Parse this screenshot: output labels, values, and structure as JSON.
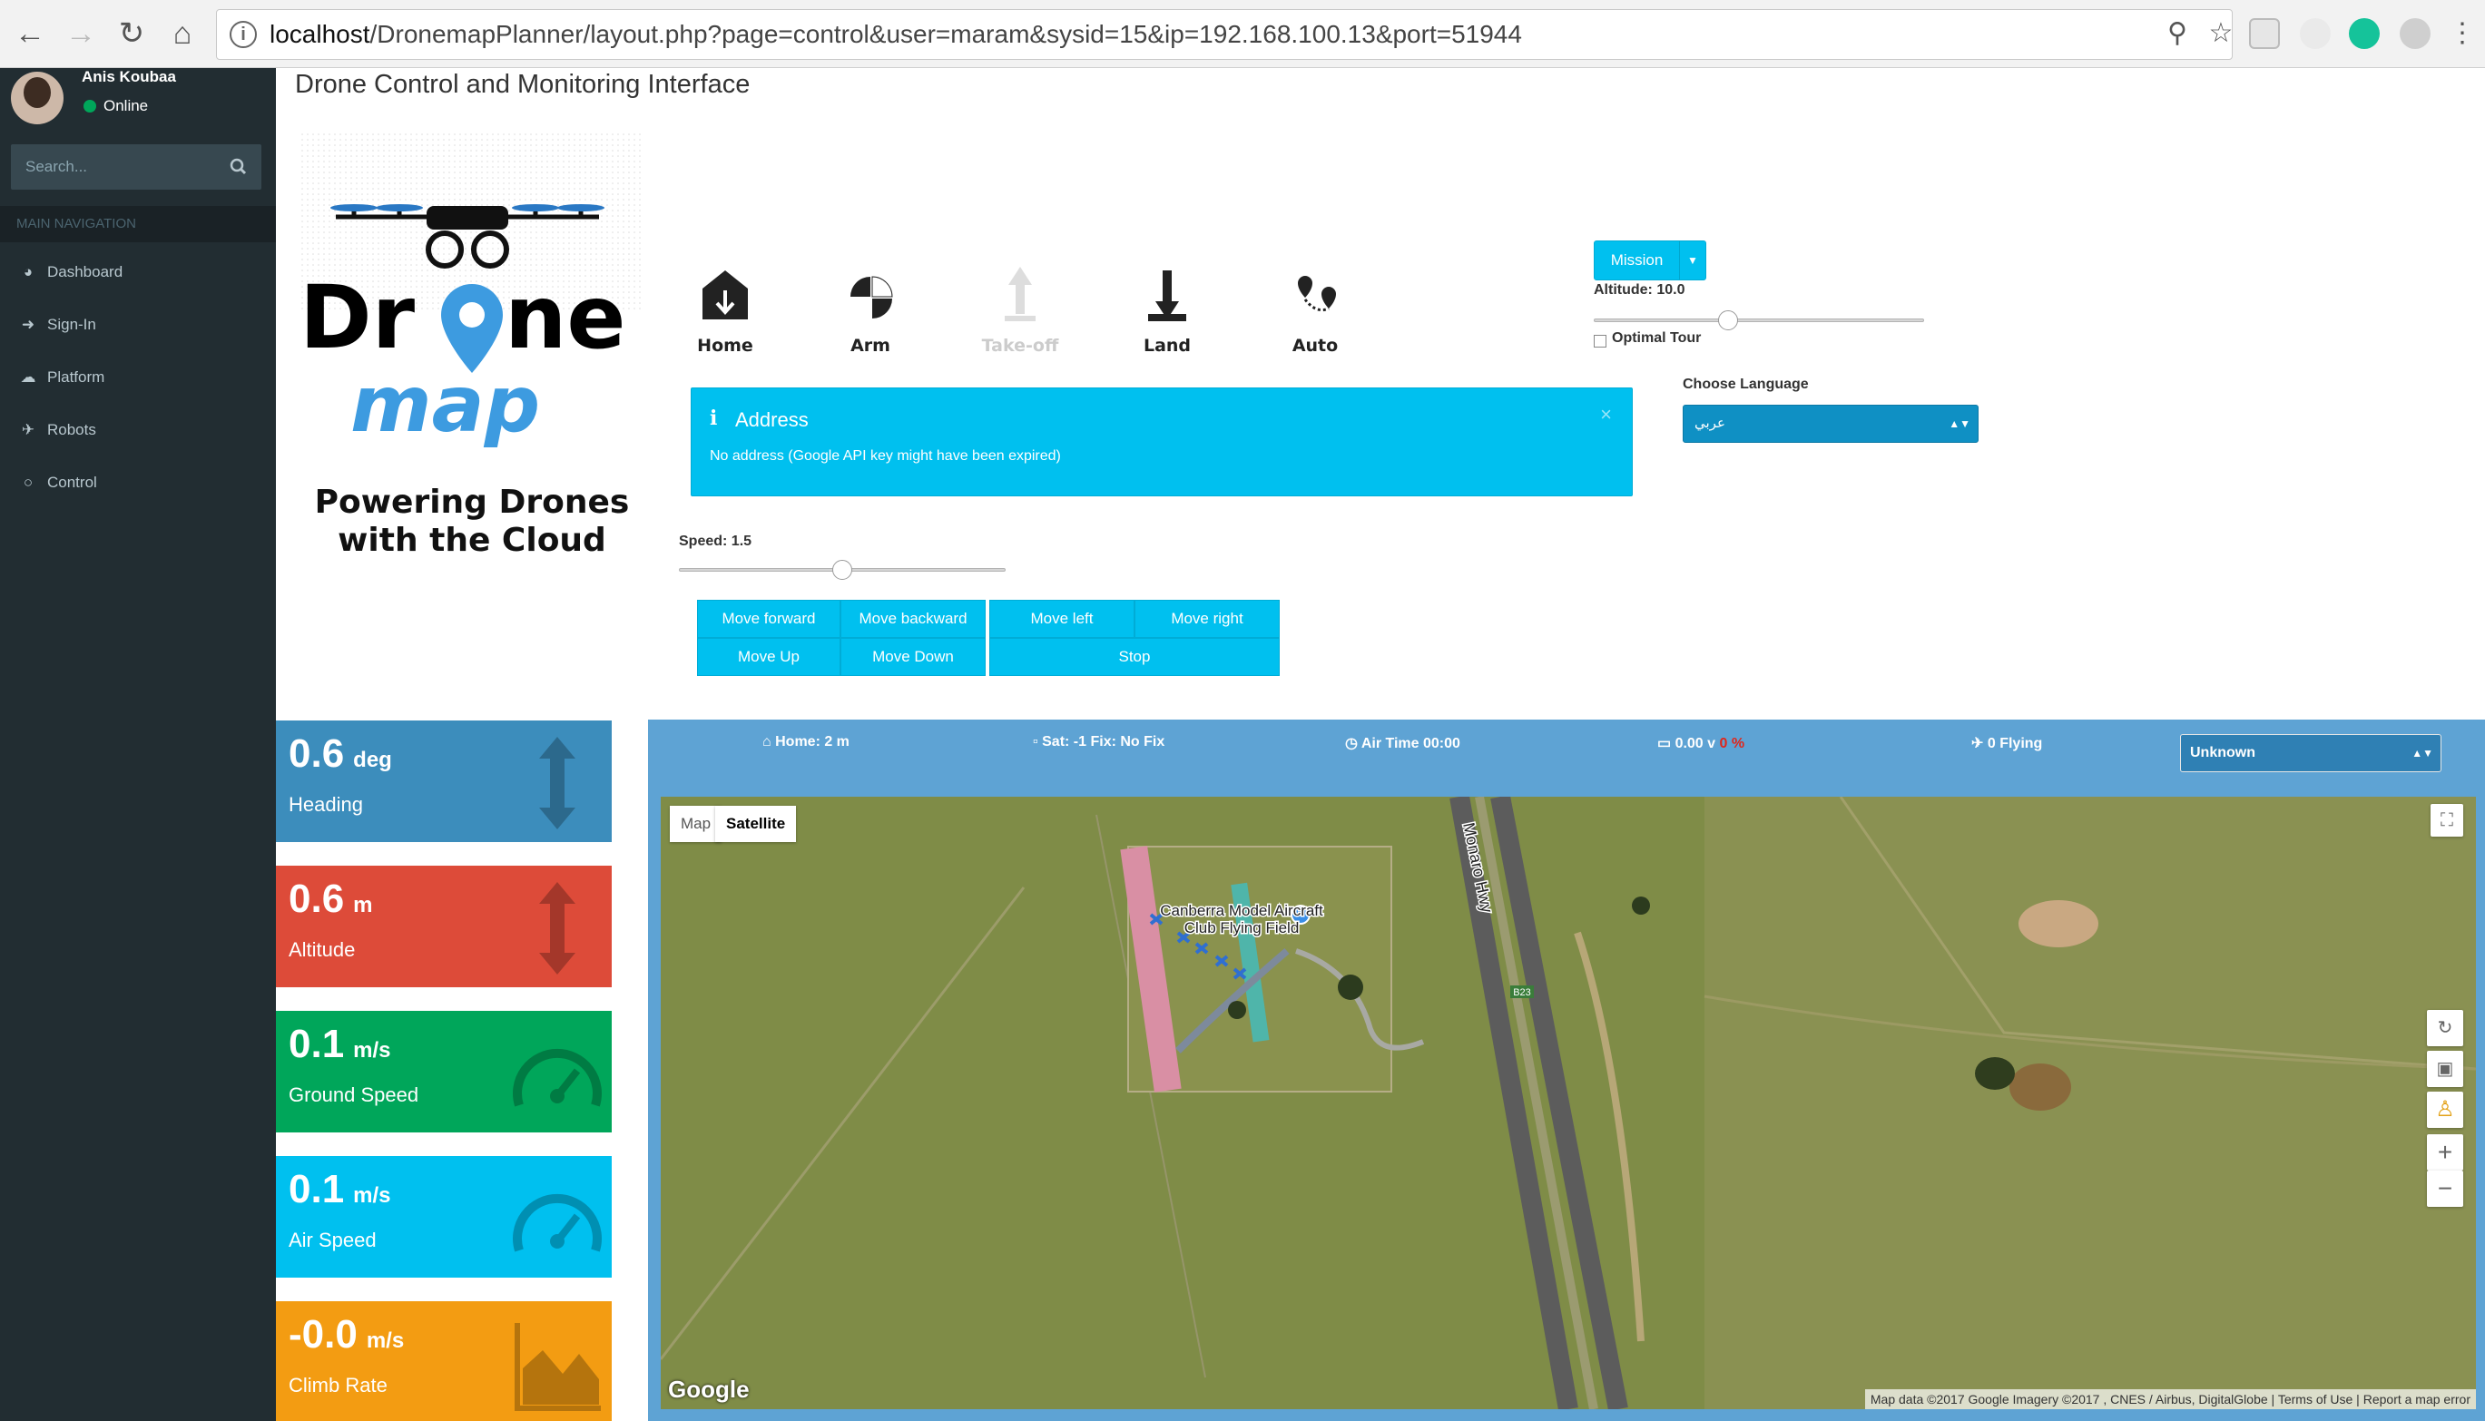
{
  "browser": {
    "url_host": "localhost",
    "url_path": "/DronemapPlanner/layout.php?page=control&user=maram&sysid=15&ip=192.168.100.13&port=51944"
  },
  "sidebar": {
    "user_name": "Anis Koubaa",
    "user_status": "Online",
    "search_placeholder": "Search...",
    "nav_header": "MAIN NAVIGATION",
    "items": [
      {
        "label": "Dashboard",
        "icon": "dashboard-icon"
      },
      {
        "label": "Sign-In",
        "icon": "sign-in-icon"
      },
      {
        "label": "Platform",
        "icon": "cloud-icon"
      },
      {
        "label": "Robots",
        "icon": "plane-icon"
      },
      {
        "label": "Control",
        "icon": "gamepad-icon"
      }
    ]
  },
  "page": {
    "title": "Drone Control and Monitoring Interface"
  },
  "logo": {
    "line1": "Drone",
    "line2": "map",
    "tagline1": "Powering Drones",
    "tagline2": "with the Cloud"
  },
  "commands": [
    {
      "label": "Home",
      "icon": "home-icon",
      "enabled": true
    },
    {
      "label": "Arm",
      "icon": "arm-icon",
      "enabled": true
    },
    {
      "label": "Take-off",
      "icon": "takeoff-icon",
      "enabled": false
    },
    {
      "label": "Land",
      "icon": "land-icon",
      "enabled": true
    },
    {
      "label": "Auto",
      "icon": "route-icon",
      "enabled": true
    }
  ],
  "mission": {
    "button_label": "Mission",
    "altitude_label": "Altitude: 10.0",
    "altitude_level": 0.4,
    "optimal_tour_label": "Optimal Tour",
    "optimal_tour_checked": false
  },
  "alert": {
    "title": "Address",
    "message": "No address (Google API key might have been expired)",
    "close": "×"
  },
  "language": {
    "label": "Choose Language",
    "selected": "عربي"
  },
  "speed": {
    "label": "Speed: 1.5",
    "level": 0.5
  },
  "movement": {
    "forward": "Move forward",
    "backward": "Move backward",
    "up": "Move Up",
    "down": "Move Down",
    "left": "Move left",
    "right": "Move right",
    "stop": "Stop"
  },
  "telemetry": [
    {
      "value": "0.6",
      "unit": "deg",
      "label": "Heading",
      "color": "#3c8dbc",
      "icon": "arrows-v-icon"
    },
    {
      "value": "0.6",
      "unit": "m",
      "label": "Altitude",
      "color": "#dd4b39",
      "icon": "arrows-v-icon"
    },
    {
      "value": "0.1",
      "unit": "m/s",
      "label": "Ground Speed",
      "color": "#00a65a",
      "icon": "speedometer-icon"
    },
    {
      "value": "0.1",
      "unit": "m/s",
      "label": "Air Speed",
      "color": "#00c0ef",
      "icon": "speedometer-icon"
    },
    {
      "value": "-0.0",
      "unit": "m/s",
      "label": "Climb Rate",
      "color": "#f39c12",
      "icon": "area-chart-icon"
    }
  ],
  "status_bar": {
    "home": "Home: 2 m",
    "sat": "Sat: -1 Fix: No Fix",
    "air_time": "Air Time 00:00",
    "battery_v": "0.00 v",
    "battery_pct": "0 %",
    "flying": "0 Flying",
    "mode_select": "Unknown"
  },
  "map": {
    "type_map": "Map",
    "type_satellite": "Satellite",
    "place_label_1": "Canberra Model Aircraft",
    "place_label_2": "Club Flying Field",
    "road_label": "Monaro Hwy",
    "road_badge": "B23",
    "google": "Google",
    "attribution": "Map data ©2017 Google Imagery ©2017 , CNES / Airbus, DigitalGlobe",
    "terms": "Terms of Use",
    "report": "Report a map error"
  }
}
